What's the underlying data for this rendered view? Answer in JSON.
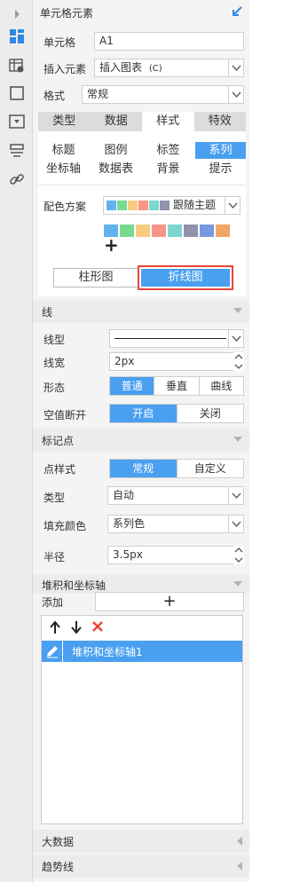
{
  "panel": {
    "title": "单元格元素"
  },
  "fields": {
    "cell_label": "单元格",
    "cell_value": "A1",
    "insert_label": "插入元素",
    "insert_value": "插入图表",
    "format_label": "格式",
    "format_value": "常规"
  },
  "tabs": [
    "类型",
    "数据",
    "样式",
    "特效"
  ],
  "subtabs": [
    "标题",
    "图例",
    "标签",
    "系列",
    "坐标轴",
    "数据表",
    "背景",
    "提示"
  ],
  "color_scheme": {
    "label": "配色方案",
    "value": "跟随主题",
    "colors": [
      "#63b2ee",
      "#76da91",
      "#f8cb7f",
      "#f89588",
      "#7cd6cf",
      "#9192ab",
      "#7898e1",
      "#efa666"
    ],
    "add_symbol": "+"
  },
  "chart_buttons": {
    "bar": "柱形图",
    "line": "折线图"
  },
  "line_section": {
    "title": "线",
    "type_label": "线型",
    "width_label": "线宽",
    "width_value": "2px",
    "shape_label": "形态",
    "shape_options": [
      "普通",
      "垂直",
      "曲线"
    ],
    "gap_label": "空值断开",
    "gap_options": [
      "开启",
      "关闭"
    ]
  },
  "marker_section": {
    "title": "标记点",
    "style_label": "点样式",
    "style_options": [
      "常规",
      "自定义"
    ],
    "type_label": "类型",
    "type_value": "自动",
    "fill_label": "填充颜色",
    "fill_value": "系列色",
    "radius_label": "半径",
    "radius_value": "3.5px"
  },
  "stack_section": {
    "title": "堆积和坐标轴",
    "add_label": "添加",
    "add_symbol": "+",
    "item": "堆积和坐标轴1"
  },
  "bigdata_section": {
    "title": "大数据"
  },
  "trend_section": {
    "title": "趋势线"
  },
  "colors": {
    "accent": "#4a9ff0",
    "highlight_border": "#e8443a",
    "remove": "#e8443a"
  }
}
